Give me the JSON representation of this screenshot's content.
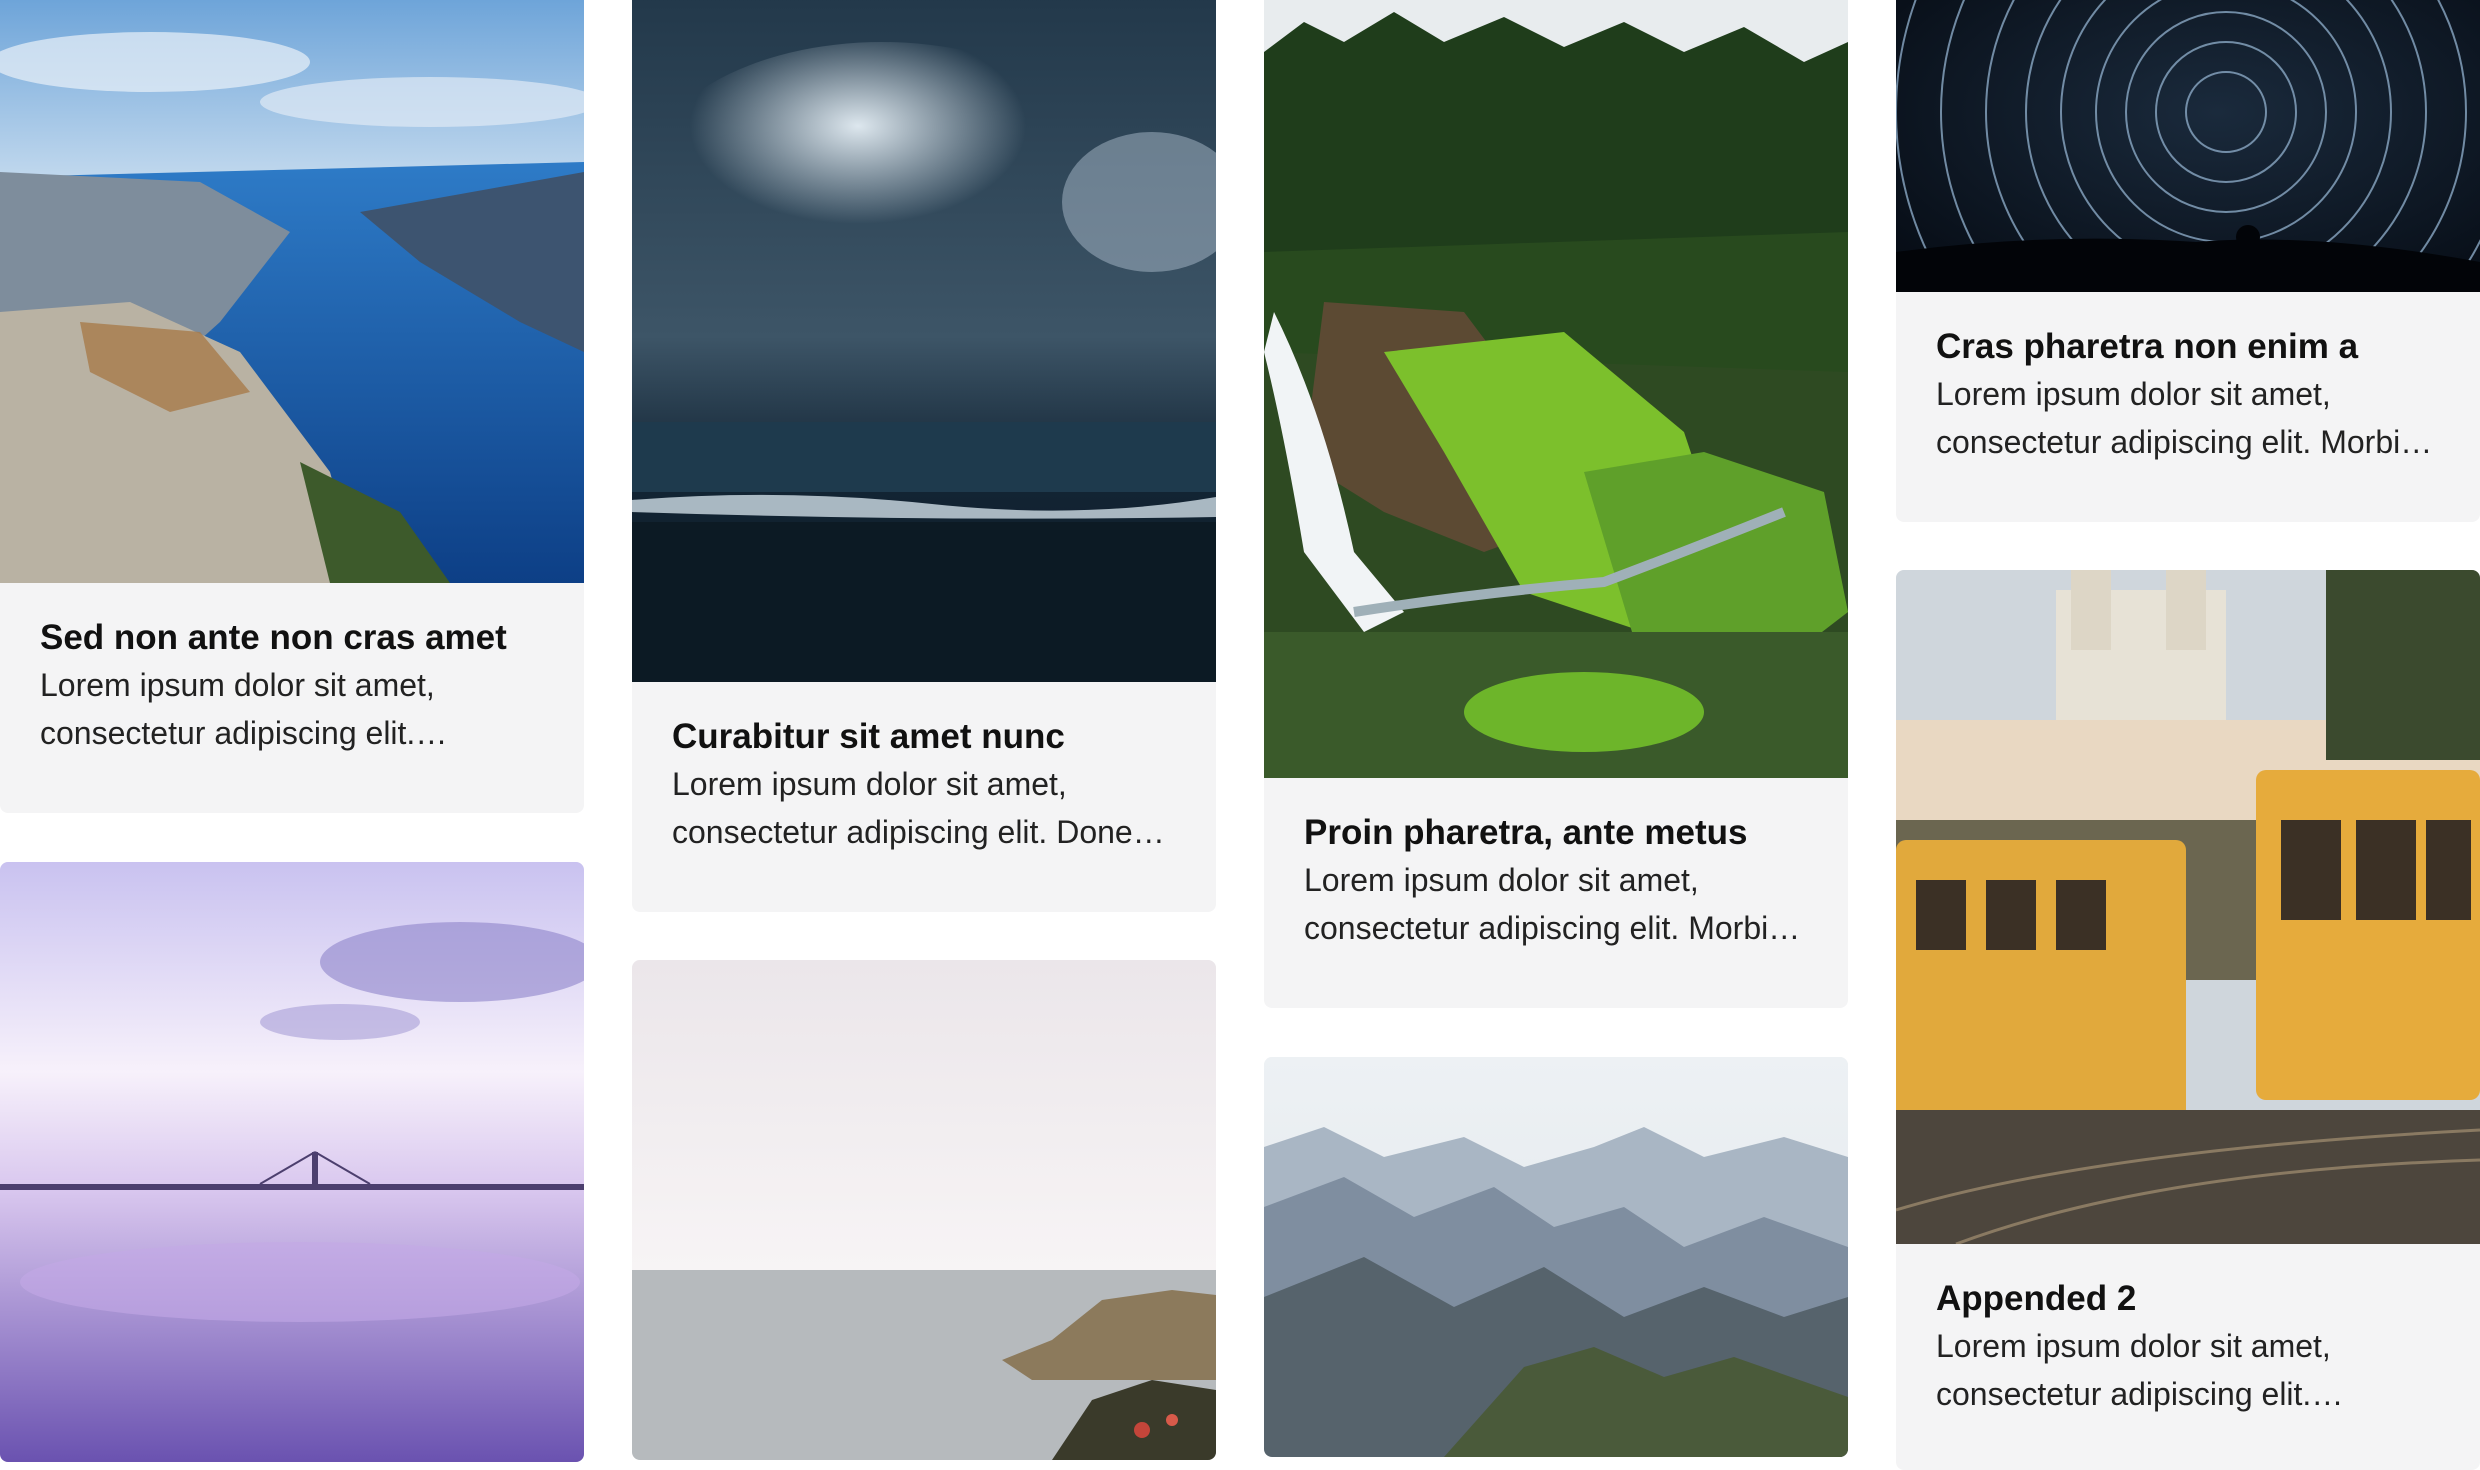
{
  "cards": [
    {
      "title": "Sed non ante non cras amet",
      "line1": "Lorem ipsum dolor sit amet,",
      "line2": "consectetur adipiscing elit.…",
      "image": "fjord-cliff-photo"
    },
    {
      "title": "",
      "line1": "",
      "line2": "",
      "image": "purple-sea-bridge-photo"
    },
    {
      "title": "Curabitur sit amet nunc",
      "line1": "Lorem ipsum dolor sit amet,",
      "line2": "consectetur adipiscing elit. Donec…",
      "image": "stormy-sea-photo"
    },
    {
      "title": "",
      "line1": "",
      "line2": "",
      "image": "coastal-rocks-photo"
    },
    {
      "title": "Proin pharetra, ante metus",
      "line1": "Lorem ipsum dolor sit amet,",
      "line2": "consectetur adipiscing elit. Morbi…",
      "image": "forest-waterfall-photo"
    },
    {
      "title": "",
      "line1": "",
      "line2": "",
      "image": "mountain-range-photo"
    },
    {
      "title": "Cras pharetra non enim a",
      "line1": "Lorem ipsum dolor sit amet,",
      "line2": "consectetur adipiscing elit. Morbi…",
      "image": "star-trails-photo"
    },
    {
      "title": "Appended 2",
      "line1": "Lorem ipsum dolor sit amet,",
      "line2": "consectetur adipiscing elit.…",
      "image": "lisbon-trams-photo"
    }
  ]
}
